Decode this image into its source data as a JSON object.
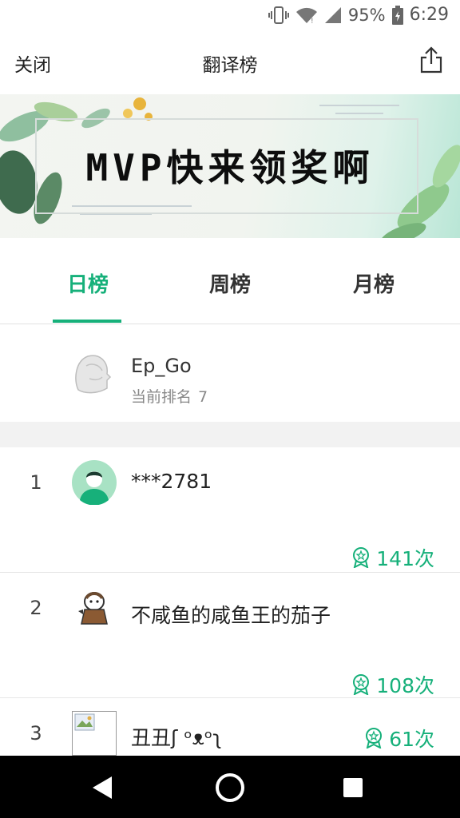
{
  "status_bar": {
    "battery_percent": "95%",
    "time": "6:29",
    "icons": [
      "vibrate-icon",
      "wifi-icon",
      "signal-icon",
      "battery-icon"
    ]
  },
  "header": {
    "close_label": "关闭",
    "title": "翻译榜",
    "share_icon": "share-icon"
  },
  "banner": {
    "text": "MVP快来领奖啊"
  },
  "tabs": [
    {
      "label": "日榜",
      "active": true
    },
    {
      "label": "周榜",
      "active": false
    },
    {
      "label": "月榜",
      "active": false
    }
  ],
  "my_rank": {
    "name": "Ep_Go",
    "rank_label": "当前排名",
    "rank_value": "7"
  },
  "ranking": [
    {
      "rank": "1",
      "name": "***2781",
      "count": "141次"
    },
    {
      "rank": "2",
      "name": "不咸鱼的咸鱼王的茄子",
      "count": "108次"
    },
    {
      "rank": "3",
      "name": "丑丑ʃ ᵒᴥᵒʅ",
      "count": "61次"
    }
  ],
  "colors": {
    "accent": "#16b07a",
    "separator": "#f2f2f2",
    "nav_bar": "#000000"
  }
}
